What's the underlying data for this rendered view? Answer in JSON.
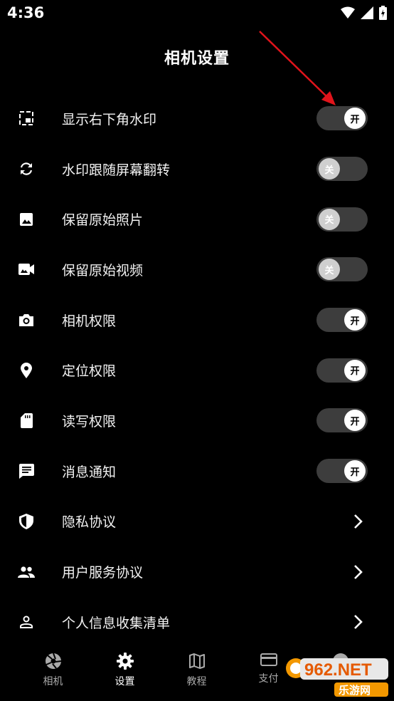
{
  "status_bar": {
    "time": "4:36"
  },
  "header": {
    "title": "相机设置"
  },
  "settings": [
    {
      "icon": "picture-in-picture-icon",
      "label": "显示右下角水印",
      "type": "toggle",
      "state": "on",
      "knob_text": "开"
    },
    {
      "icon": "rotate-sync-icon",
      "label": "水印跟随屏幕翻转",
      "type": "toggle",
      "state": "off",
      "knob_text": "关"
    },
    {
      "icon": "image-icon",
      "label": "保留原始照片",
      "type": "toggle",
      "state": "off",
      "knob_text": "关"
    },
    {
      "icon": "video-camera-icon",
      "label": "保留原始视频",
      "type": "toggle",
      "state": "off",
      "knob_text": "关"
    },
    {
      "icon": "camera-icon",
      "label": "相机权限",
      "type": "toggle",
      "state": "on",
      "knob_text": "开"
    },
    {
      "icon": "location-pin-icon",
      "label": "定位权限",
      "type": "toggle",
      "state": "on",
      "knob_text": "开"
    },
    {
      "icon": "sd-card-icon",
      "label": "读写权限",
      "type": "toggle",
      "state": "on",
      "knob_text": "开"
    },
    {
      "icon": "message-icon",
      "label": "消息通知",
      "type": "toggle",
      "state": "on",
      "knob_text": "开"
    },
    {
      "icon": "shield-icon",
      "label": "隐私协议",
      "type": "link"
    },
    {
      "icon": "people-icon",
      "label": "用户服务协议",
      "type": "link"
    },
    {
      "icon": "person-icon",
      "label": "个人信息收集清单",
      "type": "link"
    }
  ],
  "bottom_nav": [
    {
      "icon": "aperture-icon",
      "label": "相机",
      "active": false
    },
    {
      "icon": "gear-icon",
      "label": "设置",
      "active": true
    },
    {
      "icon": "map-icon",
      "label": "教程",
      "active": false
    },
    {
      "icon": "card-icon",
      "label": "支付",
      "active": false
    },
    {
      "icon": "avatar-icon",
      "label": "",
      "active": false
    }
  ],
  "watermark": {
    "text_top": "962.NET",
    "text_bottom": "乐游网"
  },
  "colors": {
    "background": "#000000",
    "toggle_track": "#3d3d3d",
    "arrow": "#e0141b"
  }
}
